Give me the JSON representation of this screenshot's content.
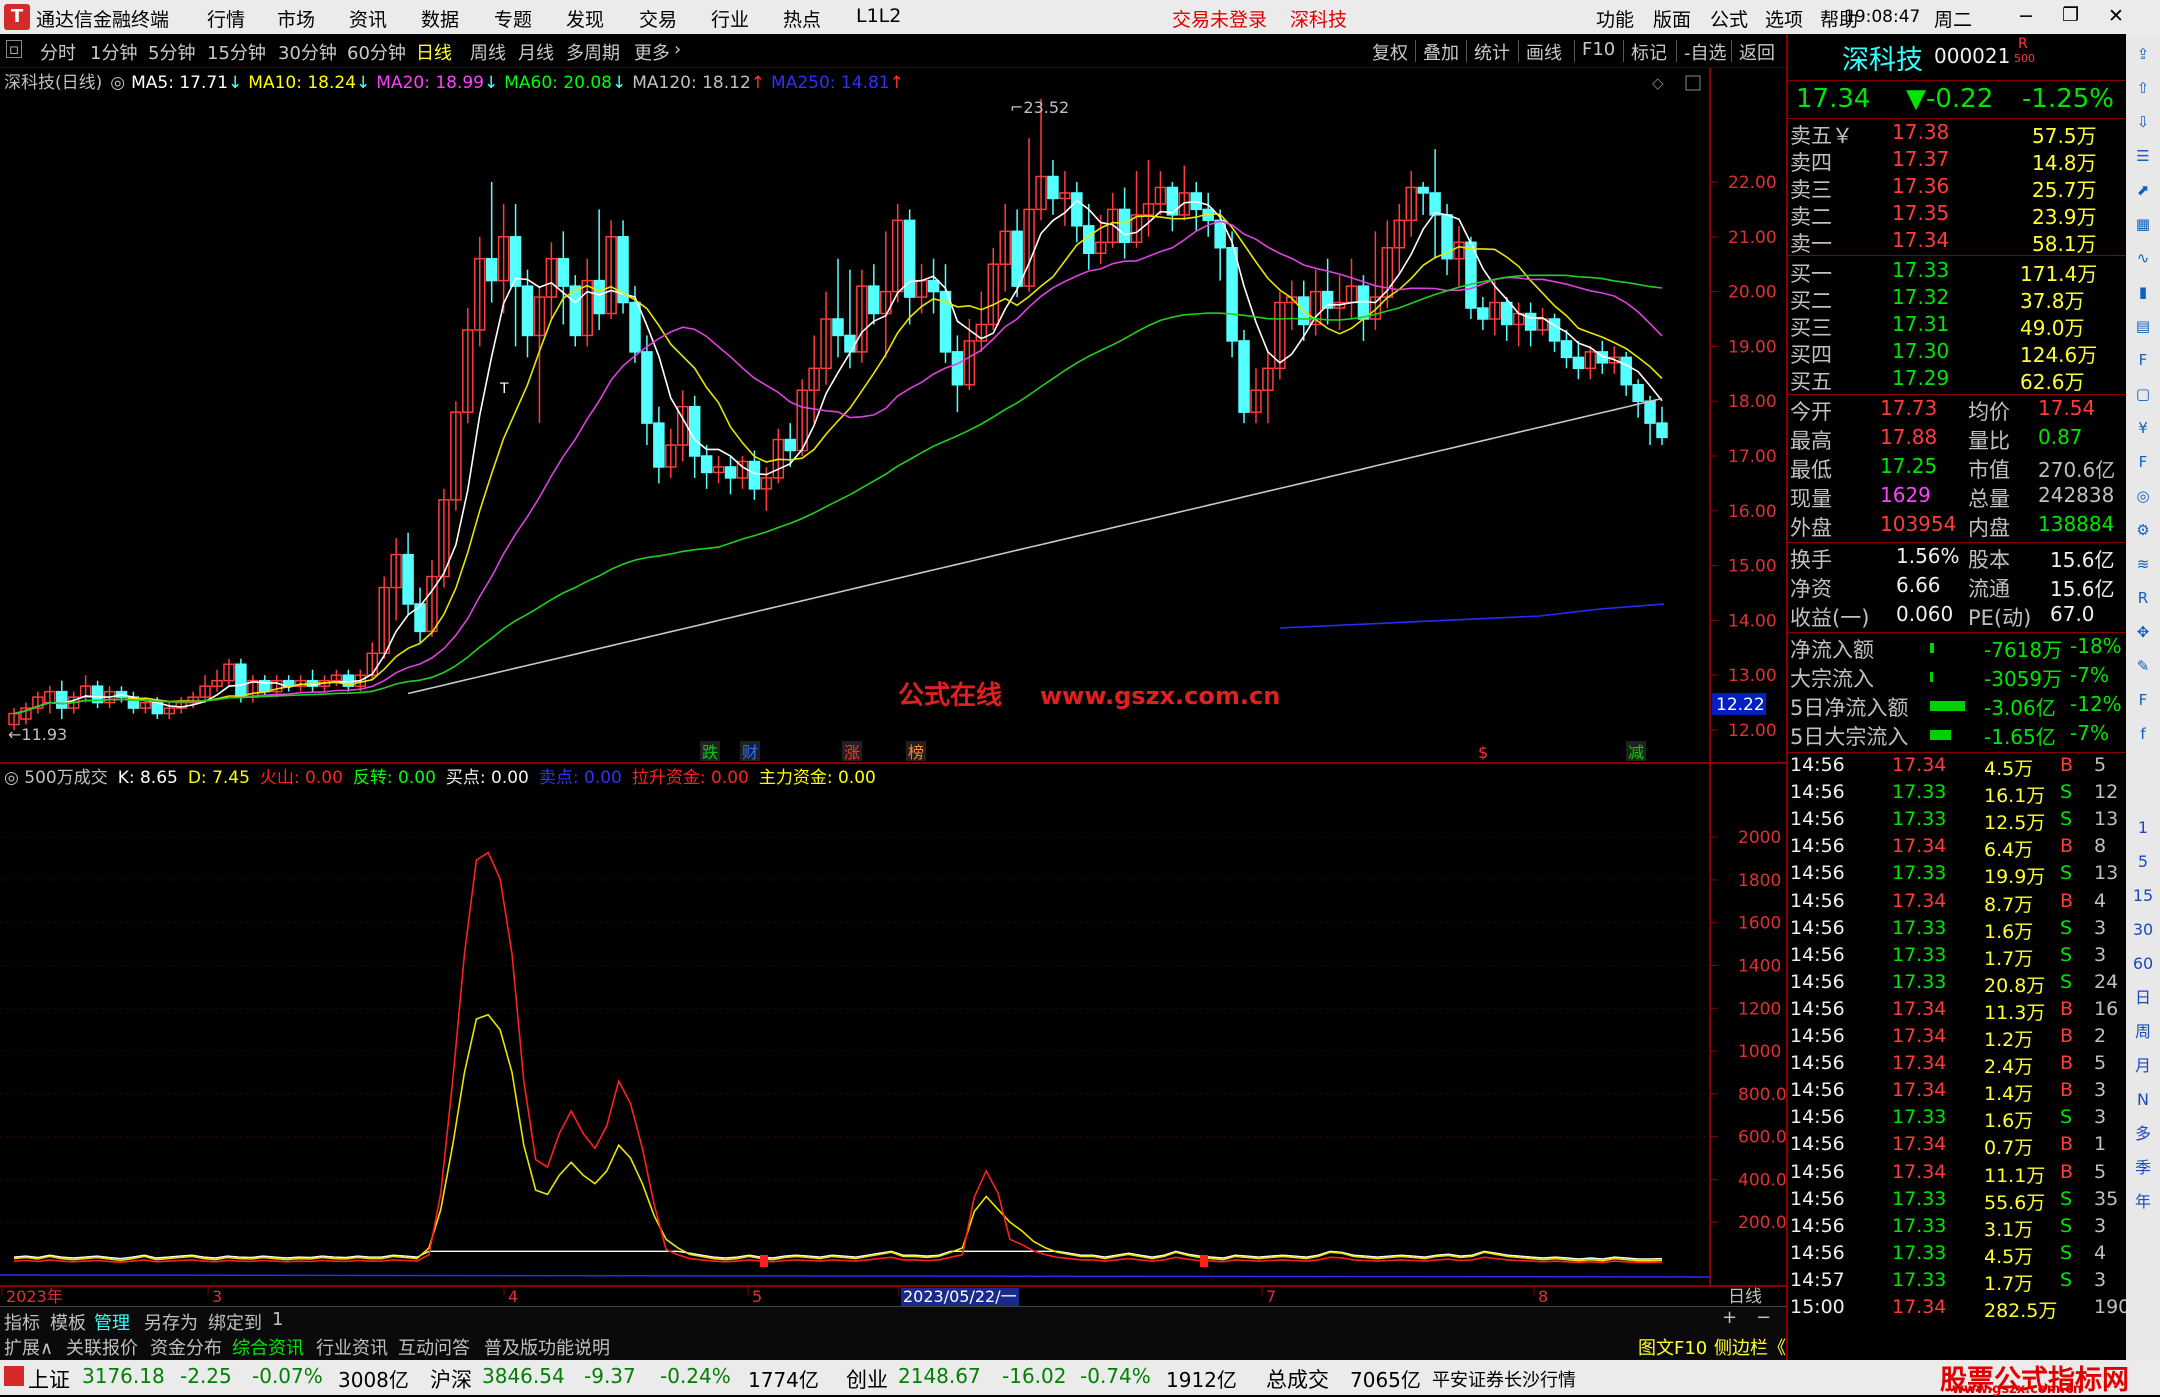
{
  "titlebar": {
    "app_title": "通达信金融终端",
    "menu": [
      "行情",
      "市场",
      "资讯",
      "数据",
      "专题",
      "发现",
      "交易",
      "行业",
      "热点",
      "L1L2"
    ],
    "login_status": "交易未登录",
    "stock_name": "深科技",
    "right_menu": [
      "功能",
      "版面",
      "公式",
      "选项",
      "帮助"
    ],
    "time": "19:08:47",
    "weekday": "周二"
  },
  "toolbar": {
    "periods": [
      "分时",
      "1分钟",
      "5分钟",
      "15分钟",
      "30分钟",
      "60分钟",
      "日线",
      "周线",
      "月线",
      "多周期",
      "更多"
    ],
    "selected_period": "日线",
    "actions": [
      "复权",
      "叠加",
      "统计",
      "画线",
      "F10",
      "标记",
      "-自选",
      "返回"
    ]
  },
  "main_chart": {
    "legend_title": "深科技(日线)",
    "ma": [
      {
        "label": "MA5: 17.71",
        "color": "#ffffff",
        "arrow": "↓"
      },
      {
        "label": "MA10: 18.24",
        "color": "#ffff00",
        "arrow": "↓"
      },
      {
        "label": "MA20: 18.99",
        "color": "#ff40ff",
        "arrow": "↓"
      },
      {
        "label": "MA60: 20.08",
        "color": "#00ff00",
        "arrow": "↓"
      },
      {
        "label": "MA120: 18.12",
        "color": "#c0c0c0",
        "arrow": "↑"
      },
      {
        "label": "MA250: 14.81",
        "color": "#3030ff",
        "arrow": "↑"
      }
    ],
    "high_label": "23.52",
    "low_label": "11.93",
    "current_price_tag": "12.22",
    "watermark": "公式在线",
    "watermark_url": "www.gszx.com.cn",
    "markers": [
      "跌",
      "财",
      "涨",
      "榜",
      "$",
      "减"
    ],
    "t_marker": "T"
  },
  "chart_data": [
    {
      "type": "candlestick",
      "yticks": [
        "22.00",
        "21.00",
        "20.00",
        "19.00",
        "18.00",
        "17.00",
        "16.00",
        "15.00",
        "14.00",
        "13.00",
        "12.00"
      ],
      "ylim": [
        11.8,
        23.8
      ]
    },
    {
      "type": "line",
      "legend": [
        {
          "label": "500万成交",
          "color": "#c0c0c0"
        },
        {
          "label": "K: 8.65",
          "color": "#ffffff"
        },
        {
          "label": "D: 7.45",
          "color": "#ffff00"
        },
        {
          "label": "火山: 0.00",
          "color": "#ff2020"
        },
        {
          "label": "反转: 0.00",
          "color": "#00ff00"
        },
        {
          "label": "买点: 0.00",
          "color": "#f0f0f0"
        },
        {
          "label": "卖点: 0.00",
          "color": "#3030ff"
        },
        {
          "label": "拉升资金: 0.00",
          "color": "#ff2020"
        },
        {
          "label": "主力资金: 0.00",
          "color": "#ffff00"
        }
      ],
      "yticks": [
        "2000",
        "1800",
        "1600",
        "1400",
        "1200",
        "1000",
        "800.0",
        "600.0",
        "400.0",
        "200.0"
      ],
      "ylim": [
        0,
        2150
      ]
    }
  ],
  "xaxis": {
    "labels": [
      "2023年",
      "3",
      "4",
      "5",
      "2023/05/22/一",
      "7",
      "8"
    ],
    "period": "日线",
    "plus": "+",
    "minus": "−"
  },
  "bottom_tabs_1": [
    "指标",
    "模板",
    "管理",
    "另存为",
    "绑定到",
    "1"
  ],
  "bottom_tabs_2": [
    "扩展∧",
    "关联报价",
    "资金分布",
    "综合资讯",
    "行业资讯",
    "互动问答",
    "普及版功能说明"
  ],
  "bottom_right": [
    "图文F10",
    "侧边栏《"
  ],
  "right_tabs": [
    "笔",
    "价",
    "细",
    "势"
  ],
  "quote": {
    "name": "深科技",
    "code": "000021",
    "flag": "R",
    "flag_sub": "500",
    "price": "17.34",
    "change": "▼-0.22",
    "pct": "-1.25%",
    "asks": [
      {
        "label": "卖五￥",
        "price": "17.38",
        "vol": "57.5万"
      },
      {
        "label": "卖四",
        "price": "17.37",
        "vol": "14.8万"
      },
      {
        "label": "卖三",
        "price": "17.36",
        "vol": "25.7万"
      },
      {
        "label": "卖二",
        "price": "17.35",
        "vol": "23.9万"
      },
      {
        "label": "卖一",
        "price": "17.34",
        "vol": "58.1万"
      }
    ],
    "bids": [
      {
        "label": "买一",
        "price": "17.33",
        "vol": "171.4万"
      },
      {
        "label": "买二",
        "price": "17.32",
        "vol": "37.8万"
      },
      {
        "label": "买三",
        "price": "17.31",
        "vol": "49.0万"
      },
      {
        "label": "买四",
        "price": "17.30",
        "vol": "124.6万"
      },
      {
        "label": "买五",
        "price": "17.29",
        "vol": "62.6万"
      }
    ],
    "stats": [
      {
        "l1": "今开",
        "v1": "17.73",
        "c1": "red",
        "l2": "均价",
        "v2": "17.54",
        "c2": "red"
      },
      {
        "l1": "最高",
        "v1": "17.88",
        "c1": "red",
        "l2": "量比",
        "v2": "0.87",
        "c2": "grn"
      },
      {
        "l1": "最低",
        "v1": "17.25",
        "c1": "grn",
        "l2": "市值",
        "v2": "270.6亿",
        "c2": "gry"
      },
      {
        "l1": "现量",
        "v1": "1629",
        "c1": "mag",
        "l2": "总量",
        "v2": "242838",
        "c2": "gry"
      },
      {
        "l1": "外盘",
        "v1": "103954",
        "c1": "red",
        "l2": "内盘",
        "v2": "138884",
        "c2": "grn"
      }
    ],
    "stats2": [
      {
        "l1": "换手",
        "v1": "1.56%",
        "l2": "股本",
        "v2": "15.6亿"
      },
      {
        "l1": "净资",
        "v1": "6.66",
        "l2": "流通",
        "v2": "15.6亿"
      },
      {
        "l1": "收益(一)",
        "v1": "0.060",
        "l2": "PE(动)",
        "v2": "67.0"
      }
    ],
    "flows": [
      {
        "label": "净流入额",
        "val": "-7618万",
        "pct": "-18%",
        "bar": 0.06
      },
      {
        "label": "大宗流入",
        "val": "-3059万",
        "pct": "-7%",
        "bar": 0.02
      },
      {
        "label": "5日净流入额",
        "val": "-3.06亿",
        "pct": "-12%",
        "bar": 0.5
      },
      {
        "label": "5日大宗流入",
        "val": "-1.65亿",
        "pct": "-7%",
        "bar": 0.3
      }
    ],
    "ticks": [
      {
        "t": "14:56",
        "p": "17.34",
        "pc": "red",
        "v": "4.5万",
        "s": "B",
        "n": "5"
      },
      {
        "t": "14:56",
        "p": "17.33",
        "pc": "grn",
        "v": "16.1万",
        "s": "S",
        "n": "12"
      },
      {
        "t": "14:56",
        "p": "17.33",
        "pc": "grn",
        "v": "12.5万",
        "s": "S",
        "n": "13"
      },
      {
        "t": "14:56",
        "p": "17.34",
        "pc": "red",
        "v": "6.4万",
        "s": "B",
        "n": "8"
      },
      {
        "t": "14:56",
        "p": "17.33",
        "pc": "grn",
        "v": "19.9万",
        "s": "S",
        "n": "13"
      },
      {
        "t": "14:56",
        "p": "17.34",
        "pc": "red",
        "v": "8.7万",
        "s": "B",
        "n": "4"
      },
      {
        "t": "14:56",
        "p": "17.33",
        "pc": "grn",
        "v": "1.6万",
        "s": "S",
        "n": "3"
      },
      {
        "t": "14:56",
        "p": "17.33",
        "pc": "grn",
        "v": "1.7万",
        "s": "S",
        "n": "3"
      },
      {
        "t": "14:56",
        "p": "17.33",
        "pc": "grn",
        "v": "20.8万",
        "s": "S",
        "n": "24"
      },
      {
        "t": "14:56",
        "p": "17.34",
        "pc": "red",
        "v": "11.3万",
        "s": "B",
        "n": "16"
      },
      {
        "t": "14:56",
        "p": "17.34",
        "pc": "red",
        "v": "1.2万",
        "s": "B",
        "n": "2"
      },
      {
        "t": "14:56",
        "p": "17.34",
        "pc": "red",
        "v": "2.4万",
        "s": "B",
        "n": "5"
      },
      {
        "t": "14:56",
        "p": "17.34",
        "pc": "red",
        "v": "1.4万",
        "s": "B",
        "n": "3"
      },
      {
        "t": "14:56",
        "p": "17.33",
        "pc": "grn",
        "v": "1.6万",
        "s": "S",
        "n": "3"
      },
      {
        "t": "14:56",
        "p": "17.34",
        "pc": "red",
        "v": "0.7万",
        "s": "B",
        "n": "1"
      },
      {
        "t": "14:56",
        "p": "17.34",
        "pc": "red",
        "v": "11.1万",
        "s": "B",
        "n": "5"
      },
      {
        "t": "14:56",
        "p": "17.33",
        "pc": "grn",
        "v": "55.6万",
        "s": "S",
        "n": "35"
      },
      {
        "t": "14:56",
        "p": "17.33",
        "pc": "grn",
        "v": "3.1万",
        "s": "S",
        "n": "3"
      },
      {
        "t": "14:56",
        "p": "17.33",
        "pc": "grn",
        "v": "4.5万",
        "s": "S",
        "n": "4"
      },
      {
        "t": "14:57",
        "p": "17.33",
        "pc": "grn",
        "v": "1.7万",
        "s": "S",
        "n": "3"
      },
      {
        "t": "15:00",
        "p": "17.34",
        "pc": "red",
        "v": "282.5万",
        "s": "",
        "n": "190"
      }
    ]
  },
  "sidebar_labels": [
    "1",
    "5",
    "15",
    "30",
    "60",
    "日",
    "周",
    "月",
    "N",
    "多",
    "季",
    "年"
  ],
  "statusbar": {
    "items": [
      {
        "name": "上证",
        "price": "3176.18",
        "chg": "-2.25",
        "pct": "-0.07%",
        "amt": "3008亿"
      },
      {
        "name": "沪深",
        "price": "3846.54",
        "chg": "-9.37",
        "pct": "-0.24%",
        "amt": "1774亿"
      },
      {
        "name": "创业",
        "price": "2148.67",
        "chg": "-16.02",
        "pct": "-0.74%",
        "amt": "1912亿"
      }
    ],
    "total_label": "总成交",
    "total_value": "7065亿",
    "broker": "平安证券长沙行情",
    "brand_name": "股票公式指标网",
    "brand_url": "www.gszx.com.cn"
  },
  "colors": {
    "up": "#ff3b3b",
    "down": "#54ffff",
    "bg": "#000000",
    "axis": "#8a0000"
  }
}
